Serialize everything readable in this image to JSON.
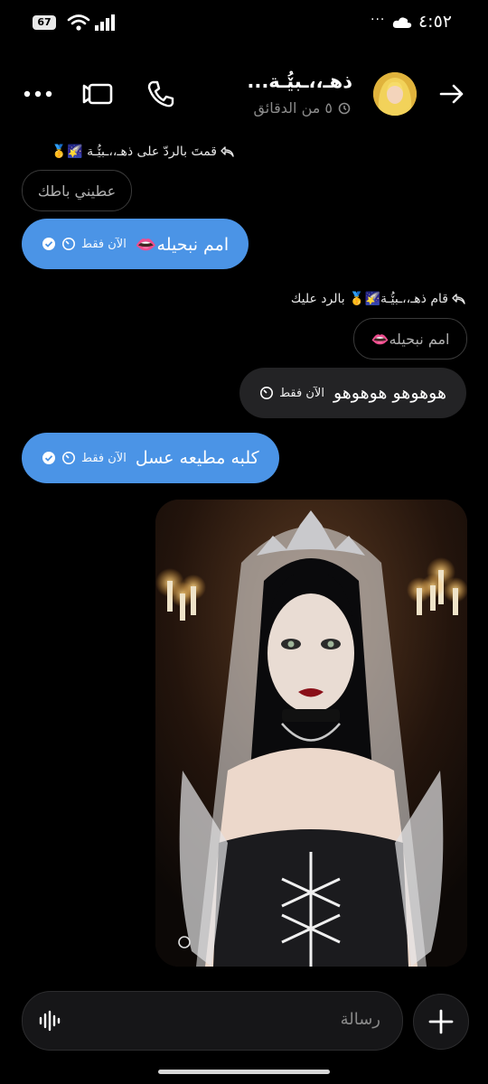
{
  "status_bar": {
    "battery": "67",
    "time": "٤:٥٢",
    "dots": "···"
  },
  "header": {
    "contact_name": "ذهـ،،ـبێُـة...",
    "last_seen": "٥ من الدقائق"
  },
  "messages": {
    "reply1_label": "قمتَ بالردّ على ذهـ،،ـبێُـة 🌠🥇",
    "reply1_quote": "عطيني باطك",
    "msg1_text": "امم نبحيله👄",
    "msg1_time": "الآن فقط",
    "reply2_label": "قام ذهـ،،ـبێُـة🌠🥇 بالرد عليك",
    "reply2_quote": "امم نبحيله👄",
    "msg2_text": "هوهوهو هوهوهو",
    "msg2_time": "الآن فقط",
    "msg3_text": "كلبه مطيعه عسل",
    "msg3_time": "الآن فقط"
  },
  "composer": {
    "placeholder": "رسالة"
  },
  "colors": {
    "sent_bubble": "#4b94e6",
    "received_bubble": "#232325",
    "background": "#000000"
  }
}
